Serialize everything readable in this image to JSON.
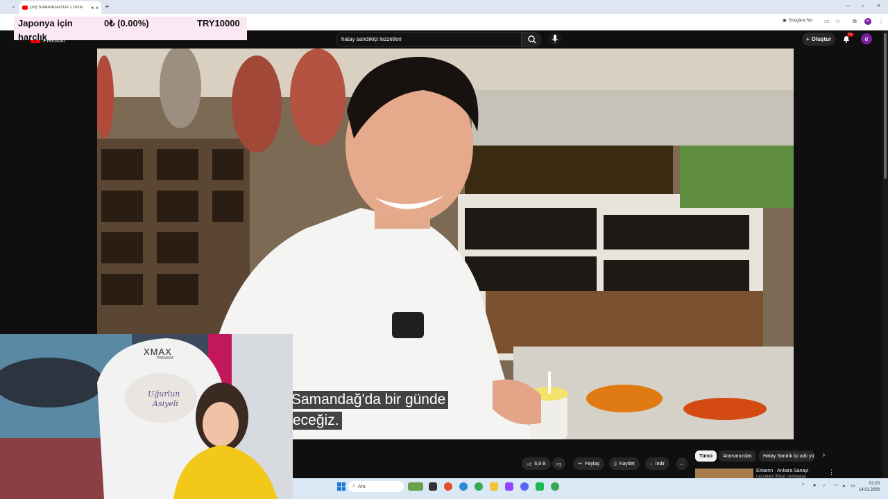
{
  "browser": {
    "tab_title": "(30) SAMANDAĞ'DA 1 GÜN",
    "google_sor": "Google'a Sor",
    "profile_initial": "K"
  },
  "overlay": {
    "line1": "Japonya için",
    "line2": "harçlık",
    "amount": "0₺ (0.00%)",
    "target": "TRY10000"
  },
  "youtube": {
    "logo_text": "Premium",
    "search_value": "hatay sandıkiçi lezzetleri",
    "create_label": "Oluştur",
    "notification_badge": "9+",
    "avatar_initial": "e"
  },
  "video": {
    "subtitle_line1": "Samandağ'da bir günde",
    "subtitle_line2": "eceğiz."
  },
  "webcam": {
    "chair_brand": "XMAX",
    "chair_sub": "PREMIUM",
    "pillow_line1": "Uğurlun",
    "pillow_line2": "Asiyeli"
  },
  "actions": {
    "like_count": "6,9 B",
    "share": "Paylaş",
    "save": "Kaydet",
    "download": "İndir",
    "more": "..."
  },
  "chips": [
    "Tümü",
    "Aramanızdan",
    "Hatay Sandık İçi adlı yü"
  ],
  "recommendation": {
    "title": "Elraenn · Ankara Sanayi",
    "subtitle": "Lezzetleri İftiyat | Ankaraya"
  },
  "taskbar": {
    "search_placeholder": "Ara",
    "time": "01:20",
    "date": "14.01.2026"
  },
  "colors": {
    "youtube_red": "#ff0000",
    "overlay_pink": "#fbe8f3",
    "hoodie_yellow": "#f2c81a"
  }
}
